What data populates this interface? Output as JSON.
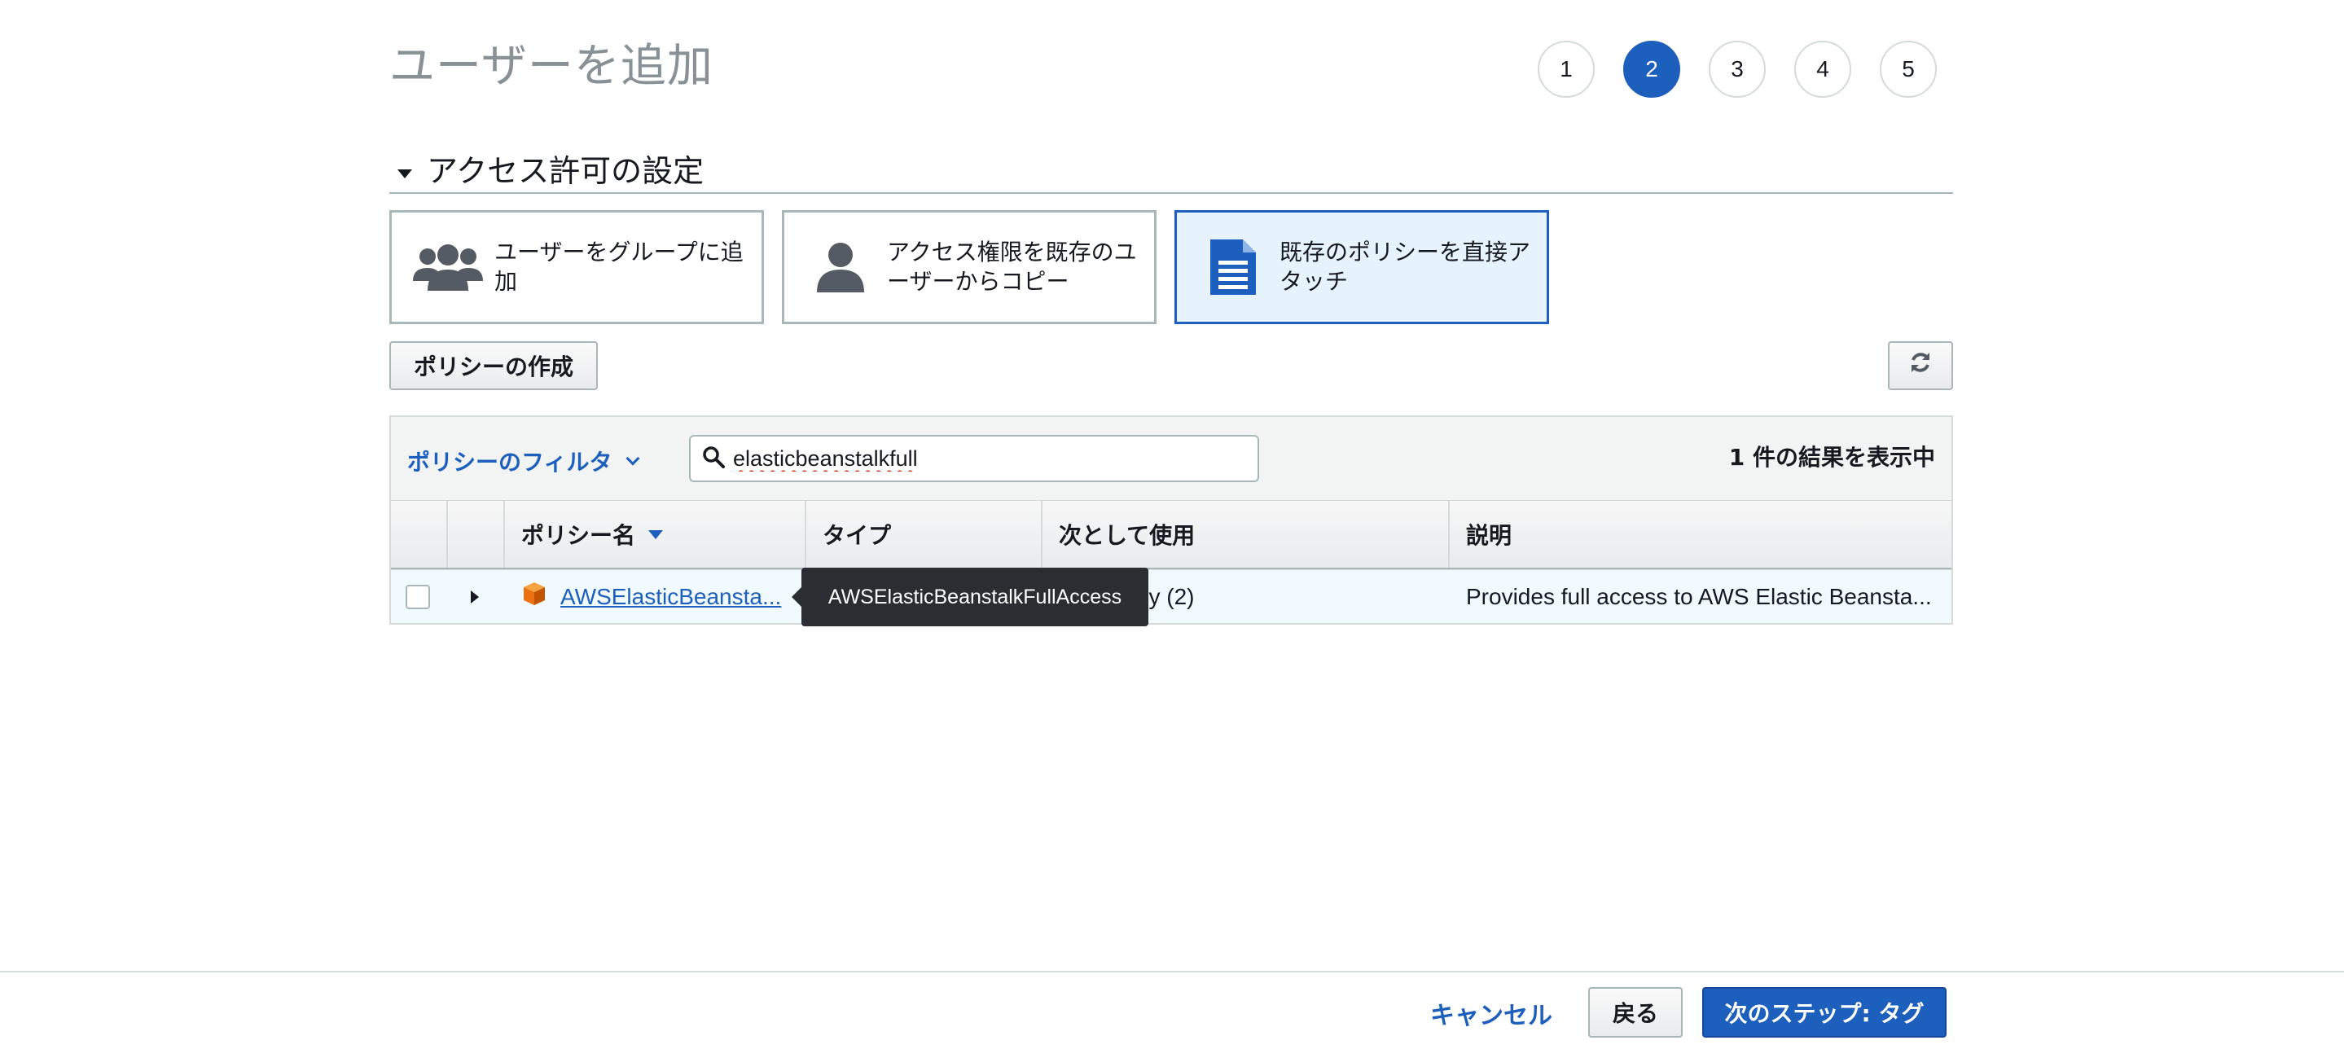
{
  "page": {
    "title": "ユーザーを追加"
  },
  "steps": [
    {
      "label": "1",
      "active": false
    },
    {
      "label": "2",
      "active": true
    },
    {
      "label": "3",
      "active": false
    },
    {
      "label": "4",
      "active": false
    },
    {
      "label": "5",
      "active": false
    }
  ],
  "section": {
    "title": "アクセス許可の設定"
  },
  "options": [
    {
      "label": "ユーザーをグループに追加",
      "icon": "user-group-icon",
      "selected": false
    },
    {
      "label": "アクセス権限を既存のユーザーからコピー",
      "icon": "user-icon",
      "selected": false
    },
    {
      "label": "既存のポリシーを直接アタッチ",
      "icon": "document-icon",
      "selected": true
    }
  ],
  "toolbar": {
    "create_policy_label": "ポリシーの作成",
    "refresh_icon": "refresh-icon"
  },
  "filter": {
    "label": "ポリシーのフィルタ",
    "search_value": "elasticbeanstalkfull",
    "result_count": "1 件の結果を表示中"
  },
  "table": {
    "headers": [
      "",
      "",
      "ポリシー名",
      "タイプ",
      "次として使用",
      "説明"
    ],
    "rows": [
      {
        "policy_name": "AWSElasticBeansta...",
        "type": "",
        "used_as": "ons policy (2)",
        "description": "Provides full access to AWS Elastic Beansta..."
      }
    ]
  },
  "tooltip": {
    "text": "AWSElasticBeanstalkFullAccess"
  },
  "footer": {
    "cancel_label": "キャンセル",
    "back_label": "戻る",
    "next_label": "次のステップ: タグ"
  },
  "colors": {
    "accent": "#1c5fbd",
    "policy_icon": "#ec7211"
  }
}
